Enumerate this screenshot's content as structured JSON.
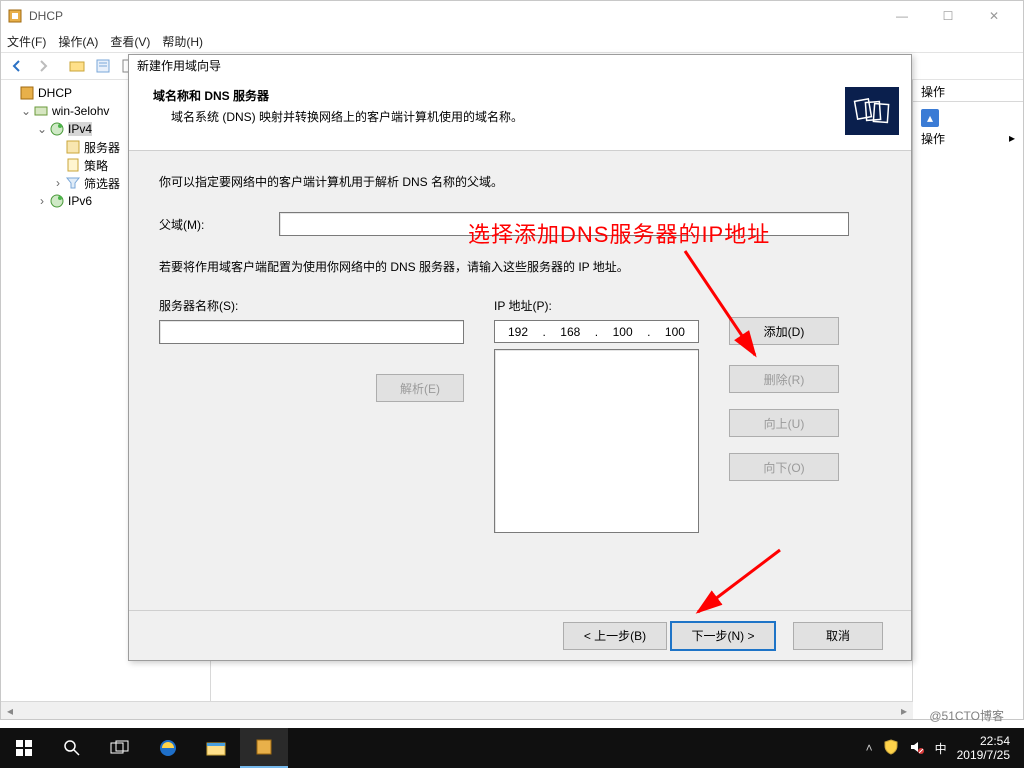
{
  "window": {
    "title": "DHCP"
  },
  "menu": {
    "file": "文件(F)",
    "action": "操作(A)",
    "view": "查看(V)",
    "help": "帮助(H)"
  },
  "tree": {
    "root": "DHCP",
    "server": "win-3elohv",
    "ipv4": "IPv4",
    "n_server_opts": "服务器",
    "n_policies": "策略",
    "n_filters": "筛选器",
    "ipv6": "IPv6"
  },
  "actions_pane": {
    "header": "操作",
    "ops": "操作"
  },
  "wizard": {
    "title": "新建作用域向导",
    "heading": "域名称和 DNS 服务器",
    "subheading": "域名系统 (DNS) 映射并转换网络上的客户端计算机使用的域名称。",
    "line1": "你可以指定要网络中的客户端计算机用于解析 DNS 名称的父域。",
    "parent_label": "父域(M):",
    "line2": "若要将作用域客户端配置为使用你网络中的 DNS 服务器，请输入这些服务器的 IP 地址。",
    "servername_label": "服务器名称(S):",
    "ip_label": "IP 地址(P):",
    "ip_octets": {
      "o1": "192",
      "o2": "168",
      "o3": "100",
      "o4": "100"
    },
    "btn_resolve": "解析(E)",
    "btn_add": "添加(D)",
    "btn_remove": "删除(R)",
    "btn_up": "向上(U)",
    "btn_down": "向下(O)",
    "btn_back": "< 上一步(B)",
    "btn_next": "下一步(N) >",
    "btn_cancel": "取消"
  },
  "annotation": {
    "text": "选择添加DNS服务器的IP地址"
  },
  "taskbar": {
    "clock_time": "22:54",
    "clock_date": "2019/7/25",
    "ime": "中"
  },
  "watermark": "@51CTO博客"
}
